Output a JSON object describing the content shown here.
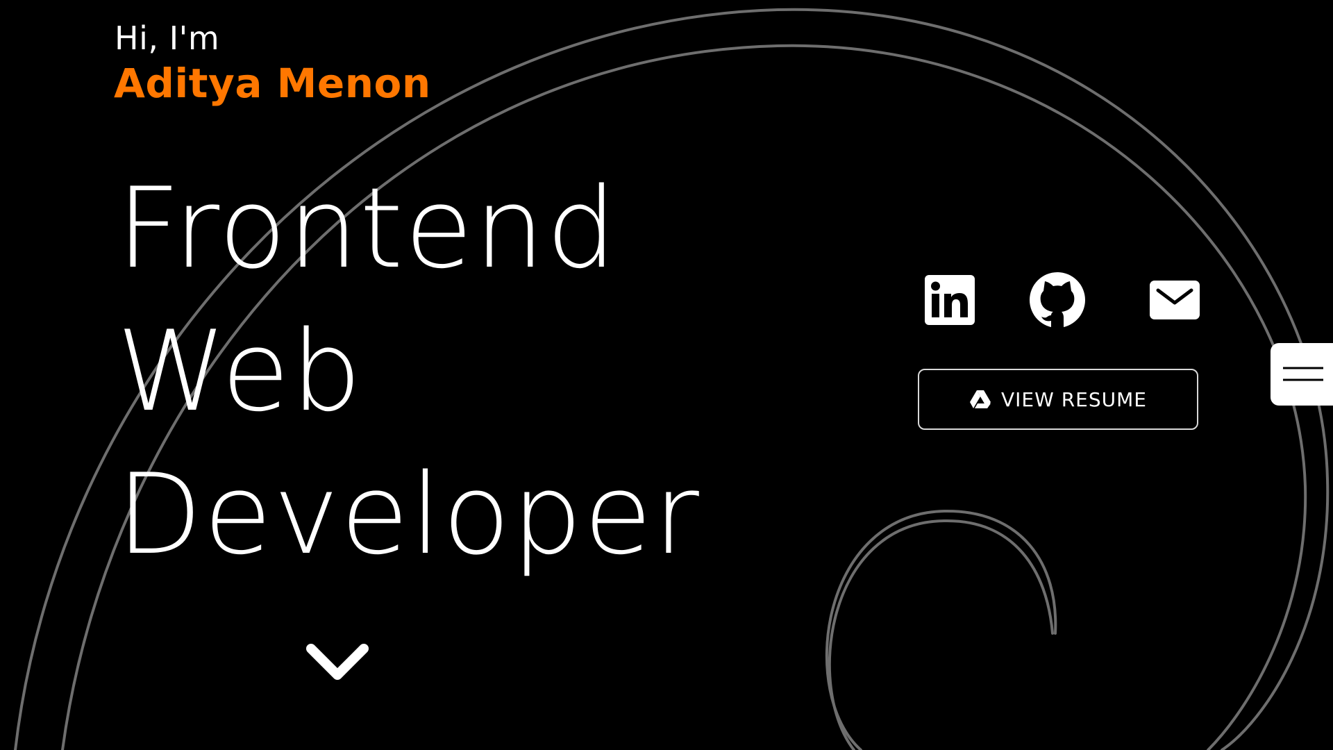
{
  "hero": {
    "greeting": "Hi, I'm",
    "name": "Aditya Menon",
    "title_lines": [
      "Frontend",
      "Web",
      "Developer"
    ]
  },
  "social": {
    "items": [
      {
        "name": "linkedin",
        "icon": "linkedin-icon"
      },
      {
        "name": "github",
        "icon": "github-icon"
      },
      {
        "name": "email",
        "icon": "mail-icon"
      }
    ]
  },
  "resume": {
    "label": "VIEW RESUME",
    "icon": "google-drive-icon"
  },
  "menu": {
    "icon": "hamburger-menu-icon"
  },
  "scroll": {
    "icon": "chevron-down-icon"
  },
  "colors": {
    "background": "#000000",
    "accent": "#ff7700",
    "text": "#ffffff",
    "decor_line": "#6e6e6e"
  }
}
